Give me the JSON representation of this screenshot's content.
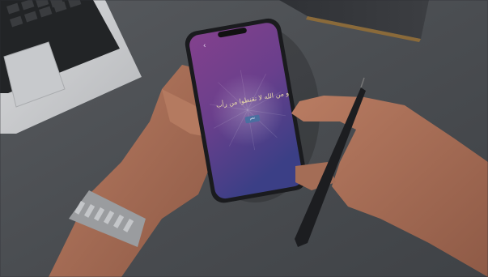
{
  "phone": {
    "back_glyph": "‹",
    "verse_text": "و من الله لا تقنطوا من رأب",
    "button_label": "نعم"
  },
  "colors": {
    "desk": "#4b4e52",
    "screen_top": "#7c3f88",
    "screen_bottom": "#3c3f86",
    "skin": "#a8705a"
  }
}
